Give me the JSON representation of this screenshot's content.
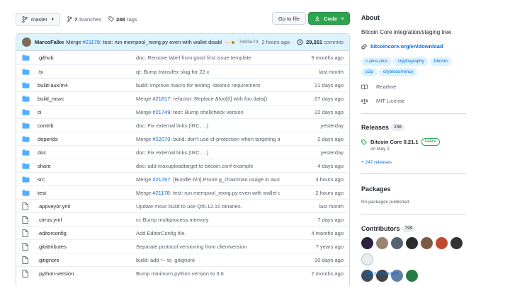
{
  "topbar": {
    "branch": "master",
    "branches_count": "7",
    "branches_label": "branches",
    "tags_count": "248",
    "tags_label": "tags",
    "goto_label": "Go to file",
    "code_label": "Code"
  },
  "commit": {
    "author": "MarcoFalke",
    "message_prefix": "Merge ",
    "message_pr": "#21178",
    "message_rest": ": test: run mempool_reorg.py even with wallet disabled",
    "ellipsis": "...",
    "sha": "7e03e74",
    "time": "2 hours ago",
    "count": "29,261",
    "count_label": "commits"
  },
  "files": [
    {
      "name": ".github",
      "type": "dir",
      "msg": "doc: Remove label from good first issue template",
      "age": "9 months ago"
    },
    {
      "name": ".tx",
      "type": "dir",
      "msg": "qt: Bump transifex slug for 22.x",
      "age": "last month"
    },
    {
      "name": "build-aux/m4",
      "type": "dir",
      "msg": "build: improve macro for testing -latomic requirement",
      "age": "21 days ago"
    },
    {
      "name": "build_msvc",
      "type": "dir",
      "msg_prefix": "Merge ",
      "msg_link": "#21817",
      "msg_rest": ": refactor: Replace &foo[0] with foo.data()",
      "age": "27 days ago"
    },
    {
      "name": "ci",
      "type": "dir",
      "msg_prefix": "Merge ",
      "msg_link": "#21749",
      "msg_rest": ": test: Bump shellcheck version",
      "age": "22 days ago"
    },
    {
      "name": "contrib",
      "type": "dir",
      "msg": "doc: Fix external links (IRC, ...)",
      "age": "yesterday"
    },
    {
      "name": "depends",
      "type": "dir",
      "msg_prefix": "Merge ",
      "msg_link": "#22070",
      "msg_rest": ": build: don't use cf-protection when targeting arm-apple...",
      "age": "2 days ago"
    },
    {
      "name": "doc",
      "type": "dir",
      "msg": "doc: Fix external links (IRC, ...)",
      "age": "yesterday"
    },
    {
      "name": "share",
      "type": "dir",
      "msg": "doc: add maxuploadtarget to bitcoin.conf example",
      "age": "4 days ago"
    },
    {
      "name": "src",
      "type": "dir",
      "msg_prefix": "Merge ",
      "msg_link": "#21767",
      "msg_rest": ": [Bundle 6/n] Prune g_chainman usage in auxiliary modules",
      "age": "3 hours ago"
    },
    {
      "name": "test",
      "type": "dir",
      "msg_prefix": "Merge ",
      "msg_link": "#21178",
      "msg_rest": ": test: run mempool_reorg.py even with wallet disabled",
      "age": "2 hours ago"
    },
    {
      "name": ".appveyor.yml",
      "type": "file",
      "msg": "Update msvc build to use Qt5.12.10 binaries.",
      "age": "last month"
    },
    {
      "name": ".cirrus.yml",
      "type": "file",
      "msg": "ci: Bump multiprocess memory",
      "age": "7 days ago"
    },
    {
      "name": ".editorconfig",
      "type": "file",
      "msg": "Add EditorConfig file.",
      "age": "4 months ago"
    },
    {
      "name": ".gitattributes",
      "type": "file",
      "msg": "Separate protocol versioning from clientversion",
      "age": "7 years ago"
    },
    {
      "name": ".gitignore",
      "type": "file",
      "msg": "build: add *~ to .gitignore",
      "age": "20 days ago"
    },
    {
      "name": ".python-version",
      "type": "file",
      "msg": "Bump minimum python version to 3.6",
      "age": "7 months ago"
    }
  ],
  "about": {
    "heading": "About",
    "description": "Bitcoin Core integration/staging tree",
    "website": "bitcoincore.org/en/download",
    "topics": [
      "c-plus-plus",
      "cryptography",
      "bitcoin",
      "p2p",
      "cryptocurrency"
    ],
    "readme": "Readme",
    "license": "MIT License"
  },
  "releases": {
    "heading": "Releases",
    "count": "248",
    "latest_name": "Bitcoin Core 0.21.1",
    "latest_badge": "Latest",
    "latest_date": "on May 2",
    "more": "+ 247 releases"
  },
  "packages": {
    "heading": "Packages",
    "empty": "No packages published"
  },
  "contributors": {
    "heading": "Contributors",
    "count": "799",
    "more": "+ 788 contributors",
    "avatar_colors": [
      "#2b2240",
      "#9a8470",
      "#556070",
      "#2c2c2c",
      "#7e5a44",
      "#c0492f",
      "#333",
      "#e8eef0",
      "#3d4d5c",
      "#444",
      "#5d7fa8",
      "#2a7a46"
    ]
  },
  "colors": {
    "link": "#0969da",
    "folder": "#54aeff",
    "code_button": "#2da44e",
    "commit_bar": "#ddf4ff"
  }
}
